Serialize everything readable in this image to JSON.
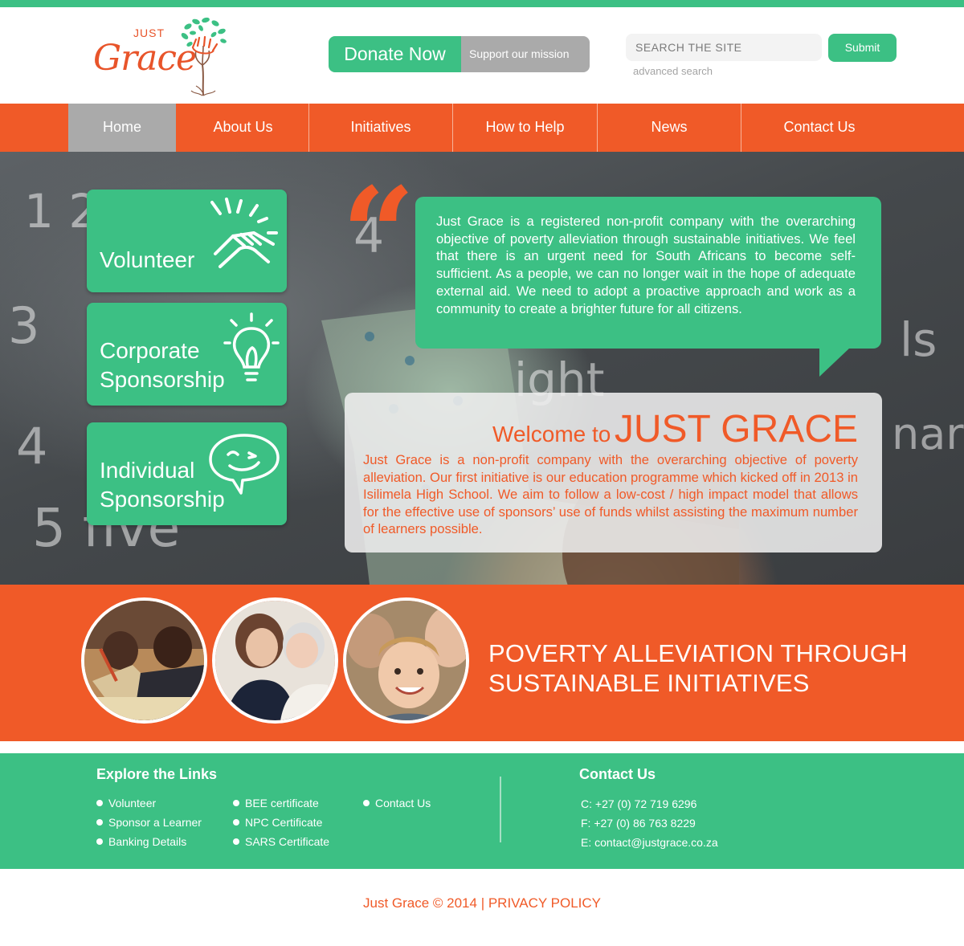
{
  "brand": {
    "logo_small": "JUST",
    "logo_script": "Grace"
  },
  "header": {
    "donate_label": "Donate Now",
    "donate_sub": "Support our mission",
    "search_placeholder": "SEARCH THE SITE",
    "submit_label": "Submit",
    "advanced_search": "advanced search"
  },
  "nav": {
    "items": [
      {
        "label": "Home",
        "active": true
      },
      {
        "label": "About Us"
      },
      {
        "label": "Initiatives"
      },
      {
        "label": "How to Help"
      },
      {
        "label": "News"
      },
      {
        "label": "Contact Us"
      }
    ]
  },
  "tiles": [
    {
      "line1": "Volunteer",
      "icon": "handshake-icon"
    },
    {
      "line1": "Corporate",
      "line2": "Sponsorship",
      "icon": "lightbulb-icon"
    },
    {
      "line1": "Individual",
      "line2": "Sponsorship",
      "icon": "smile-speech-icon"
    }
  ],
  "quote": {
    "mark": "“",
    "text": "Just Grace is a registered non-profit company with the overarching objective of poverty alleviation through sustainable initiatives. We feel that there is an urgent need for South Africans to become self-sufficient. As a people, we can no longer wait in the hope of adequate external aid. We need to adopt a proactive approach and work as a community to create a brighter future for all citizens."
  },
  "welcome": {
    "prefix": "Welcome to",
    "name": "JUST GRACE",
    "text": "Just Grace is a non-profit company with the overarching objective of poverty alleviation. Our first initiative is our education programme which kicked off in 2013 in Isilimela High School. We aim to follow a low-cost / high impact model that allows for the effective use of sponsors’ use of funds whilst assisting the maximum number of learners possible."
  },
  "banner": {
    "line1": "POVERTY ALLEVIATION THROUGH",
    "line2": "SUSTAINABLE INITIATIVES"
  },
  "footer": {
    "links_title": "Explore the Links",
    "links": [
      [
        "Volunteer",
        "Sponsor a Learner",
        "Banking Details"
      ],
      [
        "BEE certificate",
        "NPC Certificate",
        "SARS Certificate"
      ],
      [
        "Contact Us"
      ]
    ],
    "contact_title": "Contact Us",
    "contact": [
      "C: +27 (0) 72 719 6296",
      "F: +27 (0) 86 763 8229",
      "E: contact@justgrace.co.za"
    ]
  },
  "copyright": {
    "text": "Just Grace © 2014 | ",
    "policy": "PRIVACY POLICY"
  },
  "colors": {
    "green": "#3cc084",
    "orange": "#f05a28",
    "grey": "#aaaaaa"
  }
}
